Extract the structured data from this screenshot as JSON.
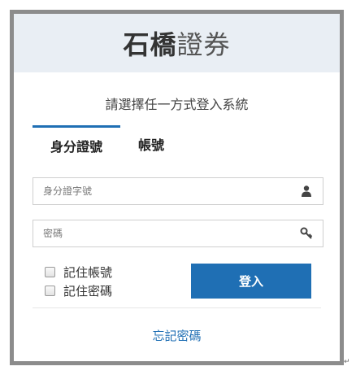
{
  "brand": {
    "bold": "石橋",
    "light": "證券"
  },
  "subtitle": "請選擇任一方式登入系統",
  "tabs": [
    {
      "label": "身分證號",
      "active": true
    },
    {
      "label": "帳號",
      "active": false
    }
  ],
  "fields": {
    "id": {
      "placeholder": "身分證字號",
      "icon": "user-icon"
    },
    "password": {
      "placeholder": "密碼",
      "icon": "key-icon"
    }
  },
  "checkboxes": [
    {
      "label": "記住帳號",
      "checked": false
    },
    {
      "label": "記住密碼",
      "checked": false
    }
  ],
  "login_label": "登入",
  "forgot_label": "忘記密碼",
  "colors": {
    "accent": "#1f6fb4",
    "header_bg": "#e9eef4",
    "frame": "#8c8c8c"
  }
}
